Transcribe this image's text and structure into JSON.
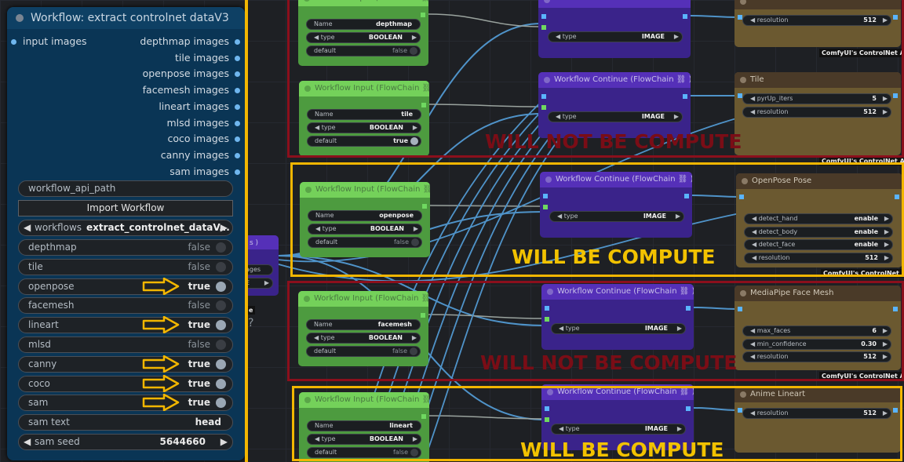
{
  "panel": {
    "title": "Workflow: extract controlnet dataV3",
    "input_label": "input images",
    "outputs": [
      "depthmap images",
      "tile images",
      "openpose images",
      "facemesh images",
      "lineart images",
      "mlsd images",
      "coco images",
      "canny images",
      "sam images"
    ],
    "api_path_label": "workflow_api_path",
    "import_button": "Import Workflow",
    "workflows": {
      "label": "workflows",
      "value": "extract_controlnet_dataV..."
    },
    "toggles": [
      {
        "label": "depthmap",
        "value": "false"
      },
      {
        "label": "tile",
        "value": "false"
      },
      {
        "label": "openpose",
        "value": "true"
      },
      {
        "label": "facemesh",
        "value": "false"
      },
      {
        "label": "lineart",
        "value": "true"
      },
      {
        "label": "mlsd",
        "value": "false"
      },
      {
        "label": "canny",
        "value": "true"
      },
      {
        "label": "coco",
        "value": "true"
      },
      {
        "label": "sam",
        "value": "true"
      }
    ],
    "sam_text": {
      "label": "sam text",
      "value": "head"
    },
    "sam_seed": {
      "label": "sam seed",
      "value": "5644660"
    }
  },
  "partial_node": {
    "line1": "s )",
    "line2": "ages",
    "line3": "E",
    "foot": "e",
    "q": "?"
  },
  "input_nodes": [
    {
      "title": "Workflow Input (FlowChain ⛓ )",
      "name_label": "Name",
      "name": "depthmap",
      "type_label": "type",
      "type": "BOOLEAN",
      "default_label": "default",
      "default": "false"
    },
    {
      "title": "Workflow Input (FlowChain ⛓ )",
      "name_label": "Name",
      "name": "tile",
      "type_label": "type",
      "type": "BOOLEAN",
      "default_label": "default",
      "default": "true"
    },
    {
      "title": "Workflow Input (FlowChain ⛓ )",
      "name_label": "Name",
      "name": "openpose",
      "type_label": "type",
      "type": "BOOLEAN",
      "default_label": "default",
      "default": "false"
    },
    {
      "title": "Workflow Input (FlowChain ⛓ )",
      "name_label": "Name",
      "name": "facemesh",
      "type_label": "type",
      "type": "BOOLEAN",
      "default_label": "default",
      "default": "false"
    },
    {
      "title": "Workflow Input (FlowChain ⛓ )",
      "name_label": "Name",
      "name": "lineart",
      "type_label": "type",
      "type": "BOOLEAN",
      "default_label": "default",
      "default": "false"
    }
  ],
  "continue_nodes": [
    {
      "title": "",
      "type_label": "type",
      "type": "IMAGE"
    },
    {
      "title": "Workflow Continue (FlowChain ⛓ )",
      "type_label": "type",
      "type": "IMAGE"
    },
    {
      "title": "Workflow Continue (FlowChain ⛓ )",
      "type_label": "type",
      "type": "IMAGE"
    },
    {
      "title": "Workflow Continue (FlowChain ⛓ )",
      "type_label": "type",
      "type": "IMAGE"
    },
    {
      "title": "Workflow Continue (FlowChain ⛓ )",
      "type_label": "type",
      "type": "IMAGE"
    }
  ],
  "preproc_nodes": [
    {
      "title": "",
      "widgets": [
        {
          "label": "resolution",
          "value": "512"
        }
      ],
      "footer": "ComfyUI's ControlNet Au..."
    },
    {
      "title": "Tile",
      "widgets": [
        {
          "label": "pyrUp_iters",
          "value": "5"
        },
        {
          "label": "resolution",
          "value": "512"
        }
      ],
      "footer": "ComfyUI's ControlNet Au..."
    },
    {
      "title": "OpenPose Pose",
      "widgets": [
        {
          "label": "detect_hand",
          "value": "enable"
        },
        {
          "label": "detect_body",
          "value": "enable"
        },
        {
          "label": "detect_face",
          "value": "enable"
        },
        {
          "label": "resolution",
          "value": "512"
        }
      ],
      "footer": "ComfyUI's ControlNet Au..."
    },
    {
      "title": "MediaPipe Face Mesh",
      "widgets": [
        {
          "label": "max_faces",
          "value": "6"
        },
        {
          "label": "min_confidence",
          "value": "0.30"
        },
        {
          "label": "resolution",
          "value": "512"
        }
      ],
      "footer": "ComfyUI's ControlNet A..."
    },
    {
      "title": "Anime Lineart",
      "widgets": [
        {
          "label": "resolution",
          "value": "512"
        }
      ],
      "footer": ""
    }
  ],
  "annotations": {
    "will_not": "WILL NOT BE COMPUTE",
    "will": "WILL BE COMPUTE"
  },
  "colors": {
    "red_box": "#8b0f1c",
    "yellow_box": "#f2b600"
  }
}
